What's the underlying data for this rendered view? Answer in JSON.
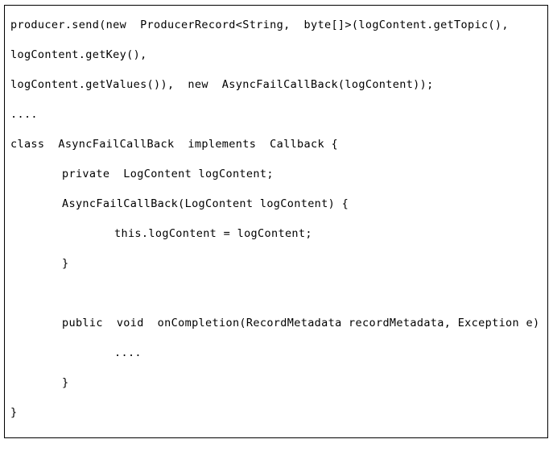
{
  "figure": {
    "kind": "code-listing",
    "language": "java",
    "border_color": "#000000",
    "background_color": "#ffffff",
    "text_color": "#000000"
  },
  "code": {
    "lines": [
      {
        "indent": 0,
        "text": "producer.send(new  ProducerRecord<String,  byte[]>(logContent.getTopic(),"
      },
      {
        "indent": 0,
        "text": "logContent.getKey(),"
      },
      {
        "indent": 0,
        "text": "logContent.getValues()),  new  AsyncFailCallBack(logContent));"
      },
      {
        "indent": 0,
        "text": "...."
      },
      {
        "indent": 0,
        "text": "class  AsyncFailCallBack  implements  Callback {"
      },
      {
        "indent": 1,
        "text": "private  LogContent logContent;"
      },
      {
        "indent": 1,
        "text": "AsyncFailCallBack(LogContent logContent) {"
      },
      {
        "indent": 2,
        "text": "this.logContent = logContent;"
      },
      {
        "indent": 1,
        "text": "}"
      },
      {
        "indent": 0,
        "text": ""
      },
      {
        "indent": 1,
        "text": "public  void  onCompletion(RecordMetadata recordMetadata, Exception e) {"
      },
      {
        "indent": 2,
        "text": "...."
      },
      {
        "indent": 1,
        "text": "}"
      },
      {
        "indent": 0,
        "text": "}"
      },
      {
        "indent": 0,
        "text": ""
      }
    ]
  }
}
